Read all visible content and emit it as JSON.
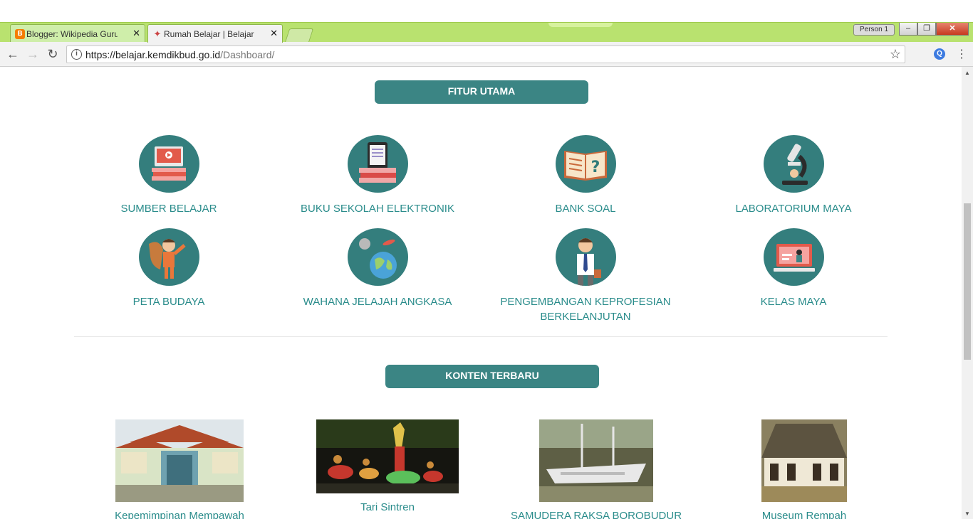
{
  "browser": {
    "tabs": [
      {
        "title": "Blogger: Wikipedia Guru",
        "favicon": "blogger-icon",
        "active": false
      },
      {
        "title": "Rumah Belajar | Belajar U",
        "favicon": "rumah-belajar-icon",
        "active": true
      }
    ],
    "profile_label": "Person 1",
    "url_host": "https://belajar.kemdikbud.go.id",
    "url_path": "/Dashboard/",
    "window_controls": {
      "minimize": "–",
      "restore": "❐",
      "close": "✕"
    }
  },
  "colors": {
    "accent": "#3b8584",
    "icon_circle": "#347e7d",
    "link_text": "#2a8c8b",
    "tabstrip": "#b9e26f"
  },
  "fitur_utama": {
    "heading": "FITUR UTAMA",
    "items": [
      {
        "label": "SUMBER BELAJAR",
        "icon": "monitor-books-icon"
      },
      {
        "label": "BUKU SEKOLAH ELEKTRONIK",
        "icon": "ebook-reader-icon"
      },
      {
        "label": "BANK SOAL",
        "icon": "open-book-question-icon"
      },
      {
        "label": "LABORATORIUM MAYA",
        "icon": "microscope-icon"
      },
      {
        "label": "PETA BUDAYA",
        "icon": "cultural-figure-icon"
      },
      {
        "label": "WAHANA JELAJAH ANGKASA",
        "icon": "planet-earth-icon"
      },
      {
        "label": "PENGEMBANGAN KEPROFESIAN BERKELANJUTAN",
        "icon": "teacher-icon"
      },
      {
        "label": "KELAS MAYA",
        "icon": "virtual-class-icon"
      }
    ]
  },
  "konten_terbaru": {
    "heading": "KONTEN TERBARU",
    "items": [
      {
        "caption": "Kepemimpinan Mempawah",
        "image": "palace-photo"
      },
      {
        "caption": "Tari Sintren",
        "image": "dance-photo"
      },
      {
        "caption": "SAMUDERA RAKSA BOROBUDUR",
        "image": "ship-photo"
      },
      {
        "caption": "Museum Rempah",
        "image": "museum-photo"
      }
    ]
  }
}
